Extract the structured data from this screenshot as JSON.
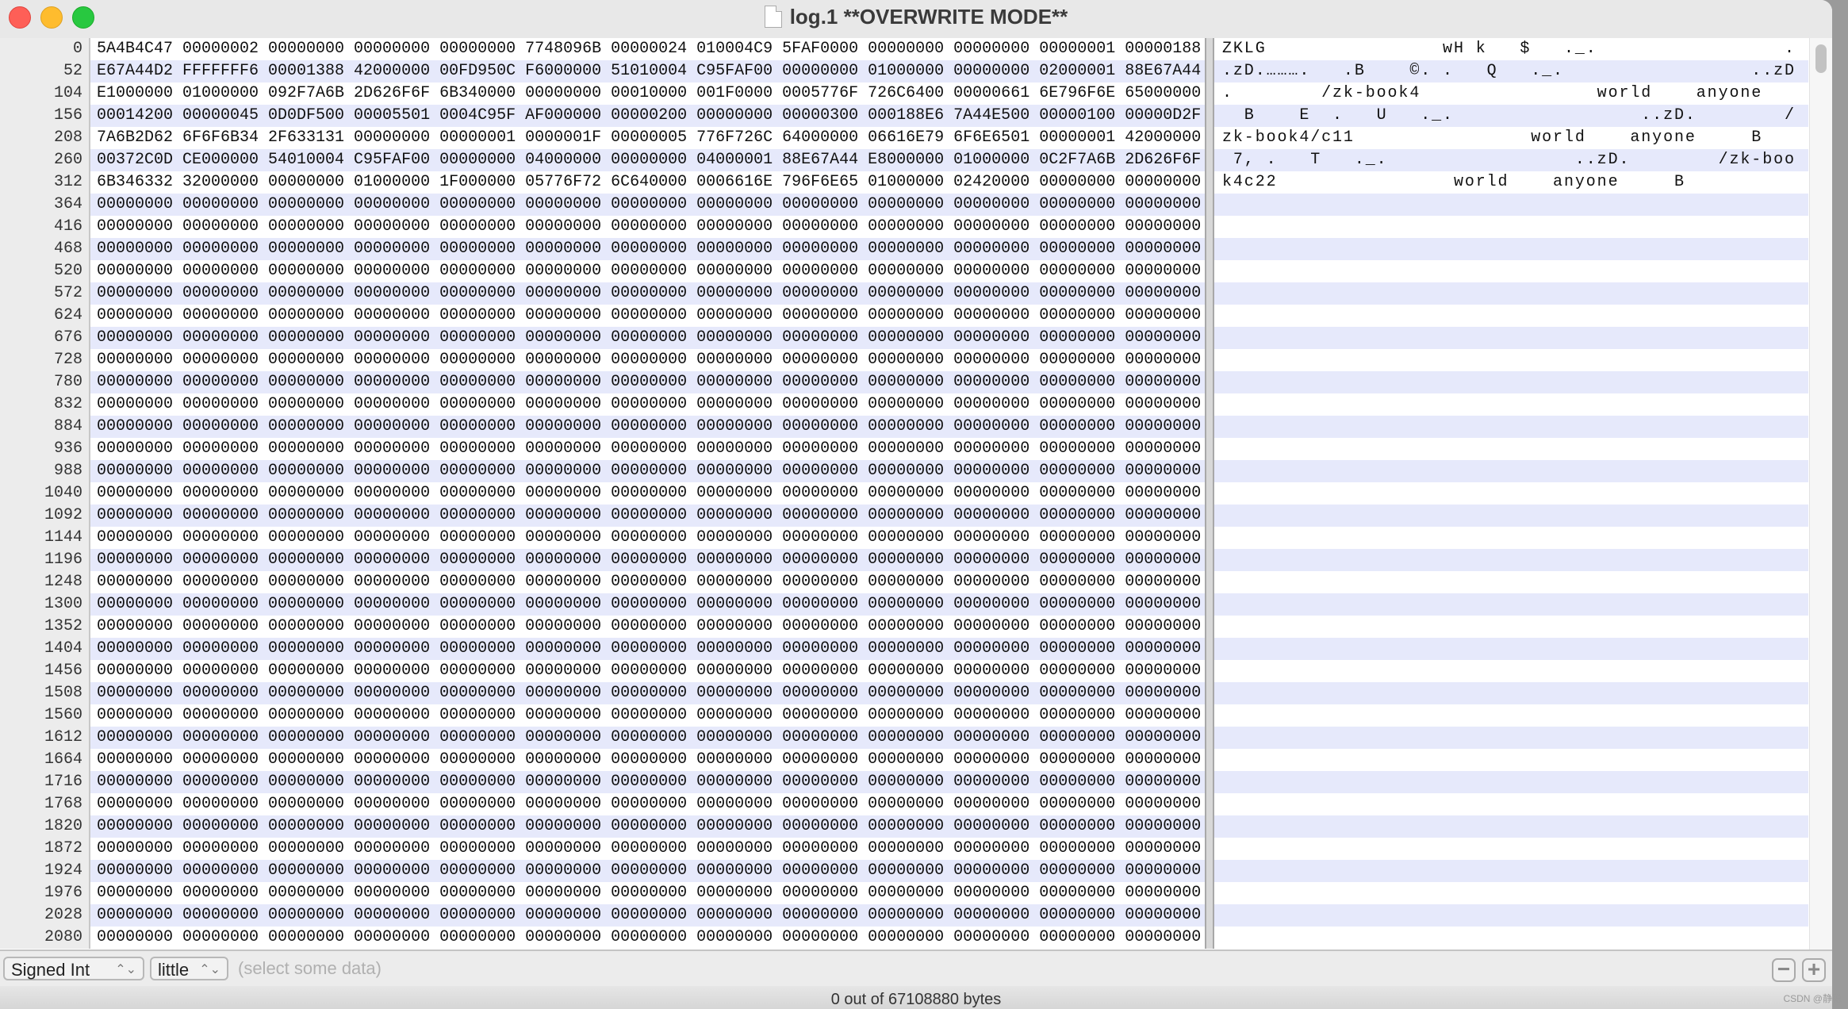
{
  "window": {
    "title": "log.1 **OVERWRITE MODE**",
    "icon": "document-icon"
  },
  "rows": [
    {
      "offset": "0",
      "hex": "5A4B4C47 00000002 00000000 00000000 00000000 7748096B 00000024 010004C9 5FAF0000 00000000 00000000 00000001 00000188",
      "ascii": "ZKLG                wH k   $   ._.                 ."
    },
    {
      "offset": "52",
      "hex": "E67A44D2 FFFFFFF6 00001388 42000000 00FD950C F6000000 51010004 C95FAF00 00000000 01000000 00000000 02000001 88E67A44",
      "ascii": ".zD.……….   .B    ©. .   Q   ._.                 ..zD"
    },
    {
      "offset": "104",
      "hex": "E1000000 01000000 092F7A6B 2D626F6F 6B340000 00000000 00010000 001F0000 0005776F 726C6400 00000661 6E796F6E 65000000",
      "ascii": ".        /zk-book4                world    anyone"
    },
    {
      "offset": "156",
      "hex": "00014200 00000045 0D0DF500 00005501 0004C95F AF000000 00000200 00000000 00000300 000188E6 7A44E500 00000100 00000D2F",
      "ascii": "  B    E  .   U   ._.                 ..zD.        /"
    },
    {
      "offset": "208",
      "hex": "7A6B2D62 6F6F6B34 2F633131 00000000 00000001 0000001F 00000005 776F726C 64000000 06616E79 6F6E6501 00000001 42000000",
      "ascii": "zk-book4/c11                world    anyone     B"
    },
    {
      "offset": "260",
      "hex": "00372C0D CE000000 54010004 C95FAF00 00000000 04000000 00000000 04000001 88E67A44 E8000000 01000000 0C2F7A6B 2D626F6F",
      "ascii": " 7, .   T   ._.                 ..zD.        /zk-boo"
    },
    {
      "offset": "312",
      "hex": "6B346332 32000000 00000000 01000000 1F000000 05776F72 6C640000 0006616E 796F6E65 01000000 02420000 00000000 00000000",
      "ascii": "k4c22                world    anyone     B"
    },
    {
      "offset": "364",
      "hex": "00000000 00000000 00000000 00000000 00000000 00000000 00000000 00000000 00000000 00000000 00000000 00000000 00000000",
      "ascii": ""
    },
    {
      "offset": "416",
      "hex": "00000000 00000000 00000000 00000000 00000000 00000000 00000000 00000000 00000000 00000000 00000000 00000000 00000000",
      "ascii": ""
    },
    {
      "offset": "468",
      "hex": "00000000 00000000 00000000 00000000 00000000 00000000 00000000 00000000 00000000 00000000 00000000 00000000 00000000",
      "ascii": ""
    },
    {
      "offset": "520",
      "hex": "00000000 00000000 00000000 00000000 00000000 00000000 00000000 00000000 00000000 00000000 00000000 00000000 00000000",
      "ascii": ""
    },
    {
      "offset": "572",
      "hex": "00000000 00000000 00000000 00000000 00000000 00000000 00000000 00000000 00000000 00000000 00000000 00000000 00000000",
      "ascii": ""
    },
    {
      "offset": "624",
      "hex": "00000000 00000000 00000000 00000000 00000000 00000000 00000000 00000000 00000000 00000000 00000000 00000000 00000000",
      "ascii": ""
    },
    {
      "offset": "676",
      "hex": "00000000 00000000 00000000 00000000 00000000 00000000 00000000 00000000 00000000 00000000 00000000 00000000 00000000",
      "ascii": ""
    },
    {
      "offset": "728",
      "hex": "00000000 00000000 00000000 00000000 00000000 00000000 00000000 00000000 00000000 00000000 00000000 00000000 00000000",
      "ascii": ""
    },
    {
      "offset": "780",
      "hex": "00000000 00000000 00000000 00000000 00000000 00000000 00000000 00000000 00000000 00000000 00000000 00000000 00000000",
      "ascii": ""
    },
    {
      "offset": "832",
      "hex": "00000000 00000000 00000000 00000000 00000000 00000000 00000000 00000000 00000000 00000000 00000000 00000000 00000000",
      "ascii": ""
    },
    {
      "offset": "884",
      "hex": "00000000 00000000 00000000 00000000 00000000 00000000 00000000 00000000 00000000 00000000 00000000 00000000 00000000",
      "ascii": ""
    },
    {
      "offset": "936",
      "hex": "00000000 00000000 00000000 00000000 00000000 00000000 00000000 00000000 00000000 00000000 00000000 00000000 00000000",
      "ascii": ""
    },
    {
      "offset": "988",
      "hex": "00000000 00000000 00000000 00000000 00000000 00000000 00000000 00000000 00000000 00000000 00000000 00000000 00000000",
      "ascii": ""
    },
    {
      "offset": "1040",
      "hex": "00000000 00000000 00000000 00000000 00000000 00000000 00000000 00000000 00000000 00000000 00000000 00000000 00000000",
      "ascii": ""
    },
    {
      "offset": "1092",
      "hex": "00000000 00000000 00000000 00000000 00000000 00000000 00000000 00000000 00000000 00000000 00000000 00000000 00000000",
      "ascii": ""
    },
    {
      "offset": "1144",
      "hex": "00000000 00000000 00000000 00000000 00000000 00000000 00000000 00000000 00000000 00000000 00000000 00000000 00000000",
      "ascii": ""
    },
    {
      "offset": "1196",
      "hex": "00000000 00000000 00000000 00000000 00000000 00000000 00000000 00000000 00000000 00000000 00000000 00000000 00000000",
      "ascii": ""
    },
    {
      "offset": "1248",
      "hex": "00000000 00000000 00000000 00000000 00000000 00000000 00000000 00000000 00000000 00000000 00000000 00000000 00000000",
      "ascii": ""
    },
    {
      "offset": "1300",
      "hex": "00000000 00000000 00000000 00000000 00000000 00000000 00000000 00000000 00000000 00000000 00000000 00000000 00000000",
      "ascii": ""
    },
    {
      "offset": "1352",
      "hex": "00000000 00000000 00000000 00000000 00000000 00000000 00000000 00000000 00000000 00000000 00000000 00000000 00000000",
      "ascii": ""
    },
    {
      "offset": "1404",
      "hex": "00000000 00000000 00000000 00000000 00000000 00000000 00000000 00000000 00000000 00000000 00000000 00000000 00000000",
      "ascii": ""
    },
    {
      "offset": "1456",
      "hex": "00000000 00000000 00000000 00000000 00000000 00000000 00000000 00000000 00000000 00000000 00000000 00000000 00000000",
      "ascii": ""
    },
    {
      "offset": "1508",
      "hex": "00000000 00000000 00000000 00000000 00000000 00000000 00000000 00000000 00000000 00000000 00000000 00000000 00000000",
      "ascii": ""
    },
    {
      "offset": "1560",
      "hex": "00000000 00000000 00000000 00000000 00000000 00000000 00000000 00000000 00000000 00000000 00000000 00000000 00000000",
      "ascii": ""
    },
    {
      "offset": "1612",
      "hex": "00000000 00000000 00000000 00000000 00000000 00000000 00000000 00000000 00000000 00000000 00000000 00000000 00000000",
      "ascii": ""
    },
    {
      "offset": "1664",
      "hex": "00000000 00000000 00000000 00000000 00000000 00000000 00000000 00000000 00000000 00000000 00000000 00000000 00000000",
      "ascii": ""
    },
    {
      "offset": "1716",
      "hex": "00000000 00000000 00000000 00000000 00000000 00000000 00000000 00000000 00000000 00000000 00000000 00000000 00000000",
      "ascii": ""
    },
    {
      "offset": "1768",
      "hex": "00000000 00000000 00000000 00000000 00000000 00000000 00000000 00000000 00000000 00000000 00000000 00000000 00000000",
      "ascii": ""
    },
    {
      "offset": "1820",
      "hex": "00000000 00000000 00000000 00000000 00000000 00000000 00000000 00000000 00000000 00000000 00000000 00000000 00000000",
      "ascii": ""
    },
    {
      "offset": "1872",
      "hex": "00000000 00000000 00000000 00000000 00000000 00000000 00000000 00000000 00000000 00000000 00000000 00000000 00000000",
      "ascii": ""
    },
    {
      "offset": "1924",
      "hex": "00000000 00000000 00000000 00000000 00000000 00000000 00000000 00000000 00000000 00000000 00000000 00000000 00000000",
      "ascii": ""
    },
    {
      "offset": "1976",
      "hex": "00000000 00000000 00000000 00000000 00000000 00000000 00000000 00000000 00000000 00000000 00000000 00000000 00000000",
      "ascii": ""
    },
    {
      "offset": "2028",
      "hex": "00000000 00000000 00000000 00000000 00000000 00000000 00000000 00000000 00000000 00000000 00000000 00000000 00000000",
      "ascii": ""
    },
    {
      "offset": "2080",
      "hex": "00000000 00000000 00000000 00000000 00000000 00000000 00000000 00000000 00000000 00000000 00000000 00000000 00000000",
      "ascii": ""
    }
  ],
  "toolbar": {
    "type_select": "Signed Int",
    "endian_select": "little",
    "value_placeholder": "(select some data)",
    "remove_label": "−",
    "add_label": "+"
  },
  "status": {
    "text": "0 out of 67108880 bytes"
  },
  "watermark": "CSDN @静聪",
  "colors": {
    "stripe": "#e6e9fb",
    "close": "#fe5f57",
    "minimize": "#febc2e",
    "zoom": "#28c840"
  }
}
